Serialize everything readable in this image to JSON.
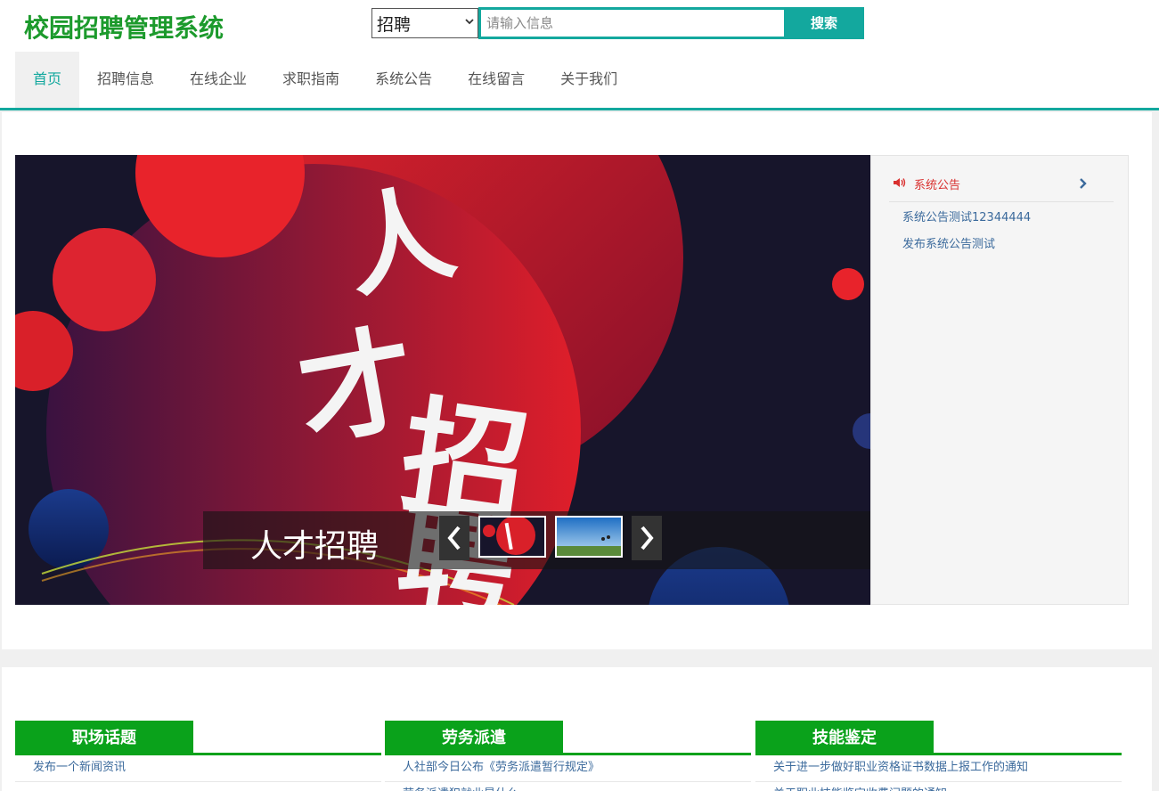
{
  "header": {
    "logo": "校园招聘管理系统",
    "search_select": "招聘",
    "search_placeholder": "请输入信息",
    "search_button": "搜索"
  },
  "nav": {
    "items": [
      {
        "label": "首页",
        "active": true
      },
      {
        "label": "招聘信息"
      },
      {
        "label": "在线企业"
      },
      {
        "label": "求职指南"
      },
      {
        "label": "系统公告"
      },
      {
        "label": "在线留言"
      },
      {
        "label": "关于我们"
      }
    ]
  },
  "banner": {
    "caption": "人才招聘",
    "art_text": [
      "人",
      "才",
      "招",
      "聘"
    ]
  },
  "notice": {
    "title": "系统公告",
    "items": [
      "系统公告测试12344444",
      "发布系统公告测试"
    ]
  },
  "columns": [
    {
      "title": "职场话题",
      "items": [
        "发布一个新闻资讯",
        ""
      ]
    },
    {
      "title": "劳务派遣",
      "items": [
        "人社部今日公布《劳务派遣暂行规定》",
        "劳务派遣犯就业是什么"
      ]
    },
    {
      "title": "技能鉴定",
      "items": [
        "关于进一步做好职业资格证书数据上报工作的通知",
        "关于职业技能鉴定收费问题的通知"
      ]
    }
  ],
  "colors": {
    "brand": "#1c9a2c",
    "accent": "#13a89e",
    "column_green": "#0aa21b",
    "link": "#3b6a9c",
    "notice_red": "#d9302f"
  }
}
